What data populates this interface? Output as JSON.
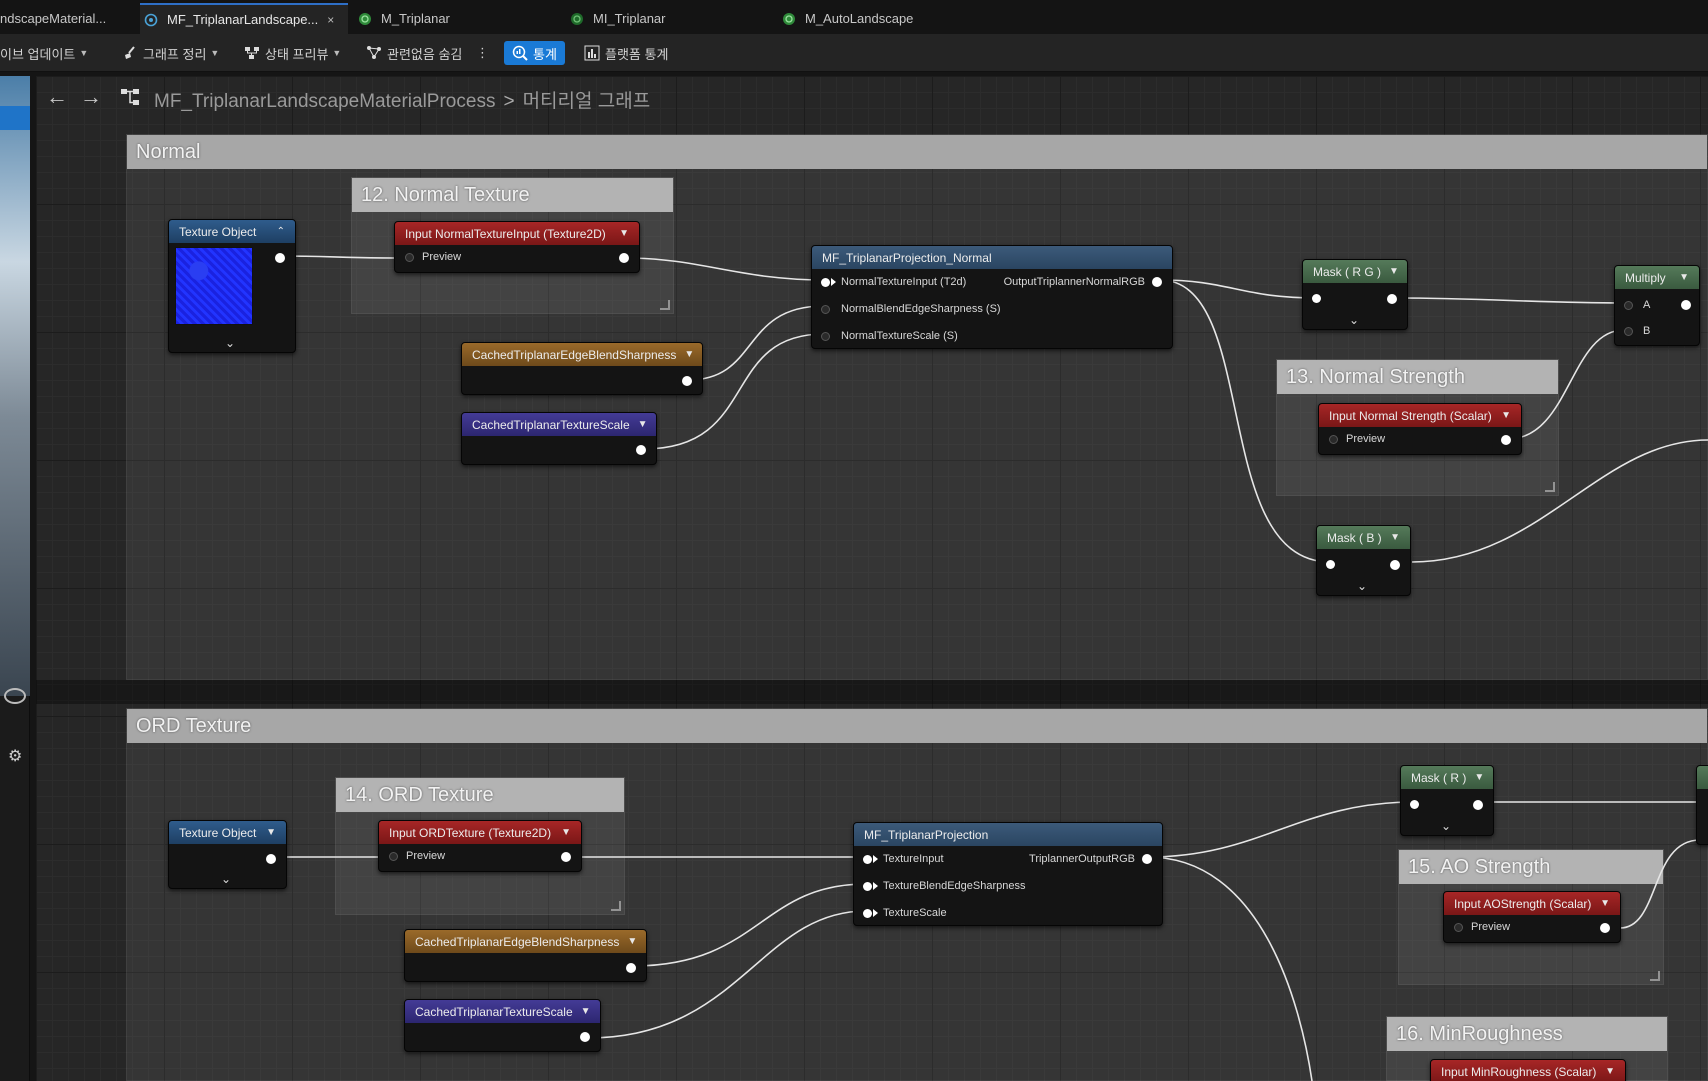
{
  "tabs": [
    {
      "label": "ndscapeMaterial...",
      "icon": "material-icon",
      "active": false
    },
    {
      "label": "MF_TriplanarLandscape...",
      "icon": "material-function-icon",
      "active": true,
      "close": "×"
    },
    {
      "label": "M_Triplanar",
      "icon": "material-icon",
      "active": false
    },
    {
      "label": "MI_Triplanar",
      "icon": "material-instance-icon",
      "active": false
    },
    {
      "label": "M_AutoLandscape",
      "icon": "material-icon",
      "active": false
    }
  ],
  "toolbar": {
    "live_update": "이브 업데이트",
    "clean_graph": "그래프 정리",
    "state_preview": "상태 프리뷰",
    "hide_unrelated": "관련없음 숨김",
    "more": "⋮",
    "stats": "통계",
    "platform_stats": "플랫폼 통계"
  },
  "graph": {
    "breadcrumb_root": "MF_TriplanarLandscapeMaterialProcess",
    "breadcrumb_sep": ">",
    "breadcrumb_leaf": "머티리얼 그래프"
  },
  "comments": {
    "normal": "Normal",
    "normal_texture": "12. Normal Texture",
    "normal_strength": "13. Normal Strength",
    "ord_texture_group": "ORD Texture",
    "ord_texture": "14. ORD Texture",
    "ao_strength": "15. AO Strength",
    "min_roughness": "16. MinRoughness"
  },
  "nodes": {
    "tex_obj_1": {
      "title": "Texture Object"
    },
    "input_normal_tex": {
      "title": "Input NormalTextureInput (Texture2D)",
      "preview": "Preview"
    },
    "cached_edge_1": {
      "title": "CachedTriplanarEdgeBlendSharpness"
    },
    "cached_scale_1": {
      "title": "CachedTriplanarTextureScale"
    },
    "proj_normal": {
      "title": "MF_TriplanarProjection_Normal",
      "in1": "NormalTextureInput (T2d)",
      "in2": "NormalBlendEdgeSharpness (S)",
      "in3": "NormalTextureScale (S)",
      "out1": "OutputTriplannerNormalRGB"
    },
    "mask_rg": {
      "title": "Mask ( R G )"
    },
    "multiply": {
      "title": "Multiply",
      "a": "A",
      "b": "B"
    },
    "input_normal_strength": {
      "title": "Input Normal Strength (Scalar)",
      "preview": "Preview"
    },
    "mask_b": {
      "title": "Mask ( B )"
    },
    "tex_obj_2": {
      "title": "Texture Object"
    },
    "input_ord_tex": {
      "title": "Input ORDTexture (Texture2D)",
      "preview": "Preview"
    },
    "cached_edge_2": {
      "title": "CachedTriplanarEdgeBlendSharpness"
    },
    "cached_scale_2": {
      "title": "CachedTriplanarTextureScale"
    },
    "proj": {
      "title": "MF_TriplanarProjection",
      "in1": "TextureInput",
      "in2": "TextureBlendEdgeSharpness",
      "in3": "TextureScale",
      "out1": "TriplannerOutputRGB"
    },
    "mask_r": {
      "title": "Mask ( R )"
    },
    "input_ao_strength": {
      "title": "Input AOStrength (Scalar)",
      "preview": "Preview"
    },
    "input_min_rough": {
      "title": "Input MinRoughness (Scalar)"
    }
  },
  "colors": {
    "accent": "#1a7ad6",
    "input_node": "#a72626",
    "cached_edge_node": "#9a6a2a",
    "cached_scale_node": "#443b96",
    "mask_node": "#557a5a",
    "function_node": "#2f5c8c"
  }
}
